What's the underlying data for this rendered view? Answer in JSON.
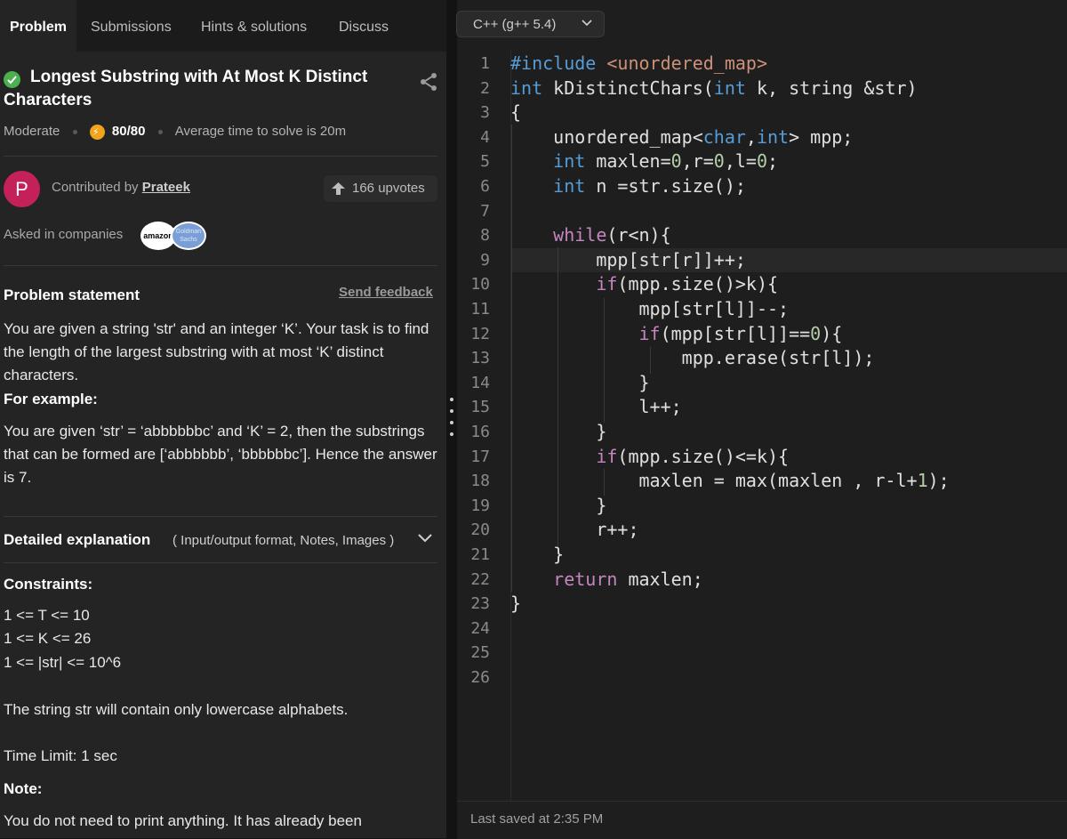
{
  "tabs": [
    {
      "label": "Problem",
      "active": true
    },
    {
      "label": "Submissions",
      "active": false
    },
    {
      "label": "Hints & solutions",
      "active": false
    },
    {
      "label": "Discuss",
      "active": false
    }
  ],
  "problem": {
    "title": "Longest Substring with At Most K Distinct Characters",
    "difficulty": "Moderate",
    "points": "80/80",
    "avg_time": "Average time to solve is 20m",
    "contributed_by_label": "Contributed by",
    "contributor": "Prateek",
    "avatar_letter": "P",
    "upvotes": "166 upvotes",
    "asked_label": "Asked in companies",
    "companies": [
      "amazon",
      "Goldman Sachs"
    ],
    "statement_heading": "Problem statement",
    "send_feedback": "Send feedback",
    "statement": "You are given a string 'str' and an integer ‘K’. Your task is to find the length of the largest substring with at most ‘K’ distinct characters.",
    "for_example": "For example:",
    "example": "You are given ‘str’ = ‘abbbbbbc’ and ‘K’ = 2, then the substrings that can be formed are [‘abbbbbb’, ‘bbbbbbc’]. Hence the answer is 7.",
    "detailed_heading": "Detailed explanation",
    "detailed_sub": "( Input/output format, Notes, Images )",
    "constraints_heading": "Constraints:",
    "constraints": [
      "1 <= T <= 10",
      "1 <= K <= 26",
      "1 <= |str| <= 10^6"
    ],
    "lowercase_note": "The string str will contain only lowercase alphabets.",
    "time_limit": "Time Limit: 1 sec",
    "note_heading": "Note:",
    "note_text": "You do not need to print anything. It has already been"
  },
  "editor": {
    "language": "C++ (g++ 5.4)",
    "last_saved": "Last saved at 2:35 PM",
    "current_line": 9,
    "line_numbers": [
      "1",
      "2",
      "3",
      "4",
      "5",
      "6",
      "7",
      "8",
      "9",
      "10",
      "11",
      "12",
      "13",
      "14",
      "15",
      "16",
      "17",
      "18",
      "19",
      "20",
      "21",
      "22",
      "23",
      "24",
      "25",
      "26"
    ],
    "lines": [
      "#include <unordered_map>",
      "int kDistinctChars(int k, string &str)",
      "{",
      "    unordered_map<char,int> mpp;",
      "    int maxlen=0,r=0,l=0;",
      "    int n =str.size();",
      "",
      "    while(r<n){",
      "        mpp[str[r]]++;",
      "        if(mpp.size()>k){",
      "            mpp[str[l]]--;",
      "            if(mpp[str[l]]==0){",
      "                mpp.erase(str[l]);",
      "            }",
      "            l++;",
      "        }",
      "        if(mpp.size()<=k){",
      "            maxlen = max(maxlen , r-l+1);",
      "        }",
      "        r++;",
      "    }",
      "    return maxlen;",
      "}",
      "",
      "",
      ""
    ]
  },
  "colors": {
    "accent_check": "#4caf50",
    "coin": "#f0a31b",
    "avatar": "#c4215a",
    "keyword": "#569cd6",
    "control": "#c586c0",
    "string": "#ce9178",
    "number": "#b5cea8"
  },
  "icons": [
    "check-circle-icon",
    "share-icon",
    "coin-icon",
    "arrow-up-icon",
    "chevron-down-icon"
  ]
}
